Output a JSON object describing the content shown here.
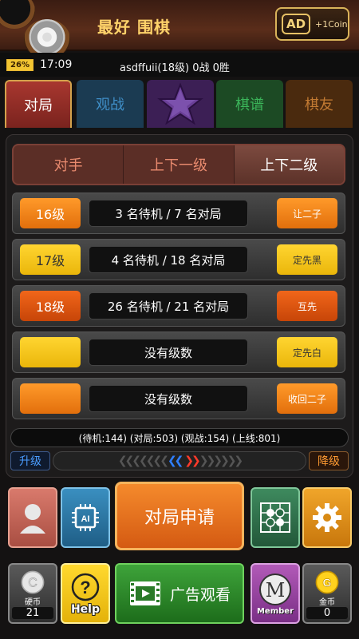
{
  "header": {
    "title": "最好 围棋",
    "ad_label": "AD",
    "ad_reward": "+1Coin"
  },
  "status": {
    "battery": "26%",
    "time": "17:09",
    "user": "asdffuii(18级) 0战 0胜"
  },
  "tabs": [
    {
      "label": "对局"
    },
    {
      "label": "观战"
    },
    {
      "label": ""
    },
    {
      "label": "棋谱"
    },
    {
      "label": "棋友"
    }
  ],
  "segments": [
    {
      "label": "对手"
    },
    {
      "label": "上下一级"
    },
    {
      "label": "上下二级"
    }
  ],
  "rows": [
    {
      "level": "16级",
      "info": "3 名待机 / 7 名对局",
      "action": "让二子"
    },
    {
      "level": "17级",
      "info": "4 名待机 / 18 名对局",
      "action": "定先黑"
    },
    {
      "level": "18级",
      "info": "26 名待机 / 21 名对局",
      "action": "互先"
    },
    {
      "level": "",
      "info": "没有级数",
      "action": "定先白"
    },
    {
      "level": "",
      "info": "没有级数",
      "action": "收回二子"
    }
  ],
  "stats": "(待机:144) (对局:503) (观战:154) (上线:801)",
  "level_up": "升级",
  "level_down": "降级",
  "main_button": "对局申请",
  "bottom": {
    "coins_label": "硬币",
    "coins_value": "21",
    "help_label": "Help",
    "watch_ad": "广告观看",
    "member_label": "Member",
    "gold_label": "金币",
    "gold_value": "0"
  }
}
